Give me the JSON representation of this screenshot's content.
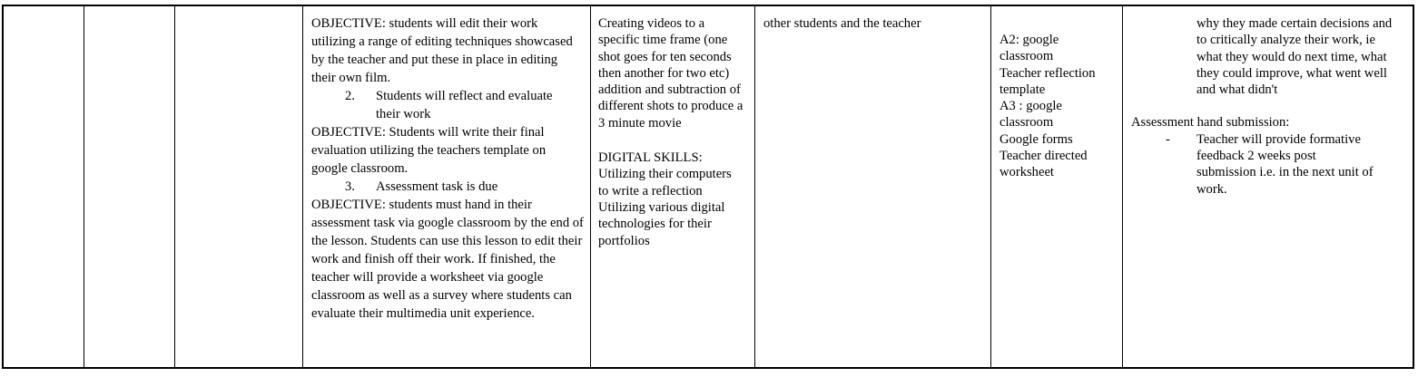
{
  "col_objectives": {
    "para1": "OBJECTIVE: students will edit their work utilizing a range of editing techniques showcased by the teacher and put these in place in editing their own film.",
    "item2_num": "2.",
    "item2_text": "Students will reflect and evaluate their work",
    "para2": "OBJECTIVE: Students will write their final evaluation utilizing the teachers template on google classroom.",
    "item3_num": "3.",
    "item3_text": "Assessment task is due",
    "para3": "OBJECTIVE: students must hand in their assessment task via google classroom by the end of the lesson. Students can use this lesson to edit their work and finish off their work. If finished, the teacher will provide a worksheet via google classroom as well as a survey where students can evaluate their multimedia unit experience."
  },
  "col_skills": {
    "line1": "Creating videos to a specific time frame (one shot goes for ten seconds then another for two etc) addition and subtraction of different shots to produce a 3 minute movie",
    "heading": "DIGITAL SKILLS:",
    "line2": "Utilizing their computers to write a reflection",
    "line3": "Utilizing various digital technologies for their portfolios"
  },
  "col_interaction": {
    "text": "other students and the teacher"
  },
  "col_resources": {
    "a2": "A2: google classroom",
    "a2_item": "Teacher reflection template",
    "a3": "A3 : google classroom",
    "a3_item1": "Google forms",
    "a3_item2": "Teacher directed worksheet"
  },
  "col_assessment": {
    "continued": "why they made certain decisions and to critically analyze their work, ie what they would do next time, what they could improve, what went well and what didn't",
    "heading": "Assessment hand submission:",
    "bullet": "-",
    "bullet_text": "Teacher will provide formative feedback 2 weeks post submission i.e. in the next unit of work."
  }
}
